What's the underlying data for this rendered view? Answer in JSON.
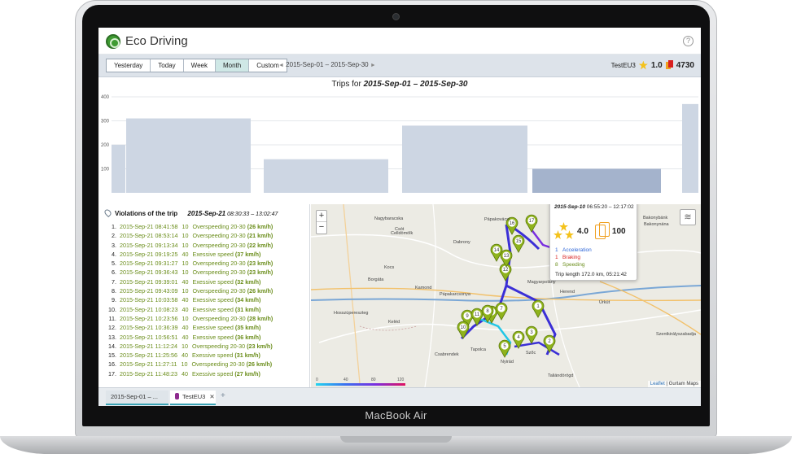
{
  "device": {
    "brand": "MacBook Air"
  },
  "app": {
    "title": "Eco Driving",
    "help": "?"
  },
  "toolbar": {
    "ranges": [
      "Yesterday",
      "Today",
      "Week",
      "Month",
      "Custom"
    ],
    "active_range": "Month",
    "period_start": "2015-Sep-01",
    "period_sep": "–",
    "period_end": "2015-Sep-30",
    "prev": "◄",
    "next": "►",
    "unit": "TestEU3",
    "rating": "1.0",
    "penalty": "4730"
  },
  "chart_data": {
    "type": "bar",
    "title_prefix": "Trips for",
    "title_range": "2015-Sep-01 – 2015-Sep-30",
    "ylim": [
      0,
      400
    ],
    "yticks": [
      "400",
      "300",
      "200",
      "100"
    ],
    "values": [
      200,
      310,
      140,
      280,
      100,
      370
    ],
    "highlighted_index": 4,
    "colors": {
      "bar": "#cdd6e3",
      "highlight": "#a4b3cc",
      "grid": "#e4e7eb"
    }
  },
  "violations": {
    "title": "Violations of the trip",
    "date": "2015-Sep-21",
    "time_range": "08:30:33 – 13:02:47",
    "rows": [
      {
        "n": "1.",
        "ts": "2015-Sep-21 08:41:58",
        "lvl": "10",
        "txt": "Overspeeding 20-30",
        "spd": "(26 km/h)"
      },
      {
        "n": "2.",
        "ts": "2015-Sep-21 08:53:14",
        "lvl": "10",
        "txt": "Overspeeding 20-30",
        "spd": "(21 km/h)"
      },
      {
        "n": "3.",
        "ts": "2015-Sep-21 09:13:34",
        "lvl": "10",
        "txt": "Overspeeding 20-30",
        "spd": "(22 km/h)"
      },
      {
        "n": "4.",
        "ts": "2015-Sep-21 09:19:25",
        "lvl": "40",
        "txt": "Exessive speed",
        "spd": "(37 km/h)"
      },
      {
        "n": "5.",
        "ts": "2015-Sep-21 09:31:27",
        "lvl": "10",
        "txt": "Overspeeding 20-30",
        "spd": "(23 km/h)"
      },
      {
        "n": "6.",
        "ts": "2015-Sep-21 09:36:43",
        "lvl": "10",
        "txt": "Overspeeding 20-30",
        "spd": "(23 km/h)"
      },
      {
        "n": "7.",
        "ts": "2015-Sep-21 09:39:01",
        "lvl": "40",
        "txt": "Exessive speed",
        "spd": "(32 km/h)"
      },
      {
        "n": "8.",
        "ts": "2015-Sep-21 09:43:09",
        "lvl": "10",
        "txt": "Overspeeding 20-30",
        "spd": "(26 km/h)"
      },
      {
        "n": "9.",
        "ts": "2015-Sep-21 10:03:58",
        "lvl": "40",
        "txt": "Exessive speed",
        "spd": "(34 km/h)"
      },
      {
        "n": "10.",
        "ts": "2015-Sep-21 10:08:23",
        "lvl": "40",
        "txt": "Exessive speed",
        "spd": "(31 km/h)"
      },
      {
        "n": "11.",
        "ts": "2015-Sep-21 10:23:56",
        "lvl": "10",
        "txt": "Overspeeding 20-30",
        "spd": "(28 km/h)"
      },
      {
        "n": "12.",
        "ts": "2015-Sep-21 10:36:39",
        "lvl": "40",
        "txt": "Exessive speed",
        "spd": "(35 km/h)"
      },
      {
        "n": "13.",
        "ts": "2015-Sep-21 10:56:51",
        "lvl": "40",
        "txt": "Exessive speed",
        "spd": "(36 km/h)"
      },
      {
        "n": "14.",
        "ts": "2015-Sep-21 11:12:24",
        "lvl": "10",
        "txt": "Overspeeding 20-30",
        "spd": "(23 km/h)"
      },
      {
        "n": "15.",
        "ts": "2015-Sep-21 11:25:56",
        "lvl": "40",
        "txt": "Exessive speed",
        "spd": "(31 km/h)"
      },
      {
        "n": "16.",
        "ts": "2015-Sep-21 11:27:11",
        "lvl": "10",
        "txt": "Overspeeding 20-30",
        "spd": "(26 km/h)"
      },
      {
        "n": "17.",
        "ts": "2015-Sep-21 11:48:23",
        "lvl": "40",
        "txt": "Exessive speed",
        "spd": "(27 km/h)"
      }
    ]
  },
  "map": {
    "zoom_in": "+",
    "zoom_out": "−",
    "layers": "≋",
    "attribution_a": "Leaflet",
    "attribution_b": "| Gurtam Maps",
    "scale": [
      "0",
      "40",
      "80",
      "120"
    ],
    "places": [
      "Nagybaracska",
      "Pápakovácsi",
      "Csót",
      "Dabrony",
      "Celldömölk",
      "Kocs",
      "Bakonybél",
      "Kamond",
      "Borgáta",
      "Pápakarcsonya",
      "Hosszúpereszteg",
      "Keléd",
      "Csabrendek",
      "Nyirád",
      "Tapolca",
      "Szőc",
      "Magyarpolány",
      "Herend",
      "Úrkút",
      "Taliándörögd",
      "Bakonybánk",
      "Szentkirályszabadja",
      "Homokbödöge",
      "Bakonynána"
    ],
    "markers": [
      "1",
      "2",
      "3",
      "4",
      "5",
      "6",
      "7",
      "8",
      "9",
      "10",
      "11",
      "12",
      "13",
      "14",
      "15",
      "16",
      "17"
    ],
    "popup": {
      "date": "2015-Sep-10",
      "time": "06:55:20 – 12:17:02",
      "rating": "4.0",
      "penalty": "100",
      "items": [
        {
          "count": "1",
          "label": "Acceleration"
        },
        {
          "count": "1",
          "label": "Braking"
        },
        {
          "count": "8",
          "label": "Speeding"
        }
      ],
      "length": "Trip length 172.0 km, 05:21:42"
    }
  },
  "tabs": {
    "items": [
      "2015-Sep-01 – ...",
      "TestEU3"
    ],
    "close": "✕",
    "add": "+"
  }
}
